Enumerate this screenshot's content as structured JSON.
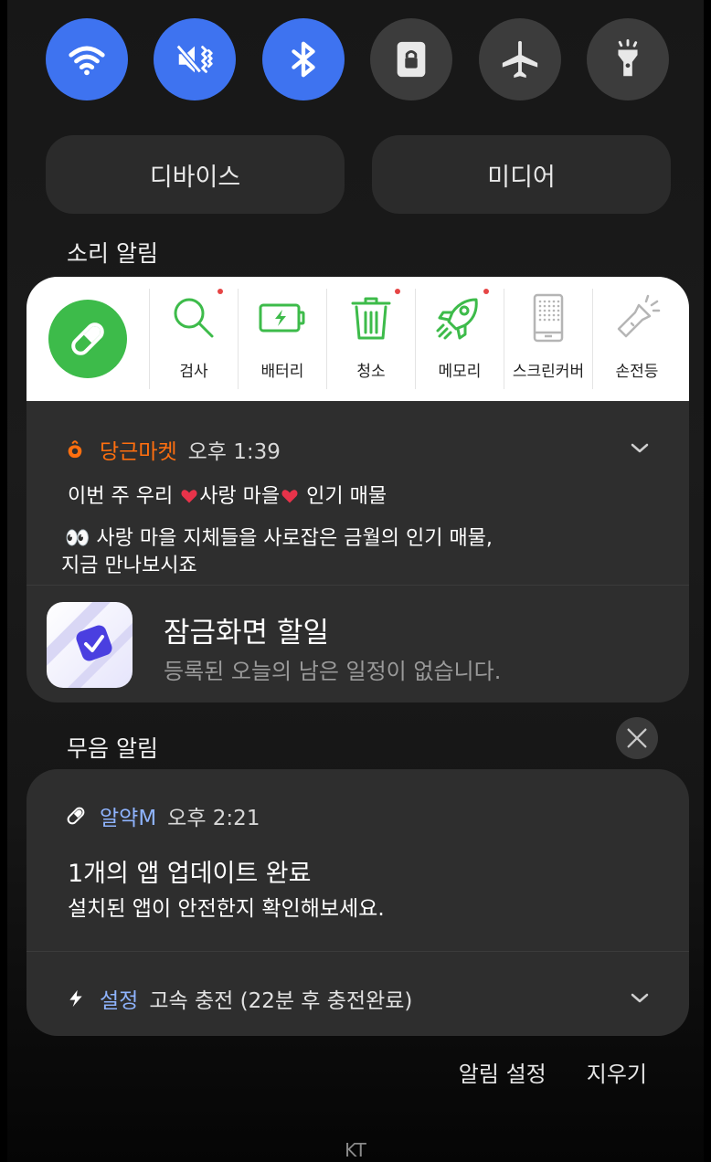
{
  "quick_toggles": [
    {
      "name": "wifi",
      "state": "on"
    },
    {
      "name": "mute",
      "state": "on"
    },
    {
      "name": "bluetooth",
      "state": "on"
    },
    {
      "name": "screen-lock",
      "state": "off"
    },
    {
      "name": "airplane-mode",
      "state": "off"
    },
    {
      "name": "flashlight",
      "state": "off"
    }
  ],
  "panel_buttons": {
    "device": "디바이스",
    "media": "미디어"
  },
  "sections": {
    "sound": "소리 알림",
    "silent": "무음 알림"
  },
  "tools": {
    "items": [
      {
        "label": "검사",
        "icon": "magnifier-icon",
        "dot": true
      },
      {
        "label": "배터리",
        "icon": "battery-icon",
        "dot": false
      },
      {
        "label": "청소",
        "icon": "trash-icon",
        "dot": true
      },
      {
        "label": "메모리",
        "icon": "rocket-icon",
        "dot": true
      },
      {
        "label": "스크린커버",
        "icon": "phone-screen-icon",
        "dot": false
      },
      {
        "label": "손전등",
        "icon": "flashlight-icon",
        "dot": false
      }
    ]
  },
  "notifications": {
    "daangn": {
      "app": "당근마켓",
      "time": "오후 1:39",
      "title_a": "이번 주 우리 ",
      "title_b": "사랑 마을",
      "title_c": " 인기 매물",
      "body_emoji": "👀",
      "body_line1": " 사랑 마을 지체들을 사로잡은 금월의 인기 매물,",
      "body_line2": "지금 만나보시죠",
      "accent": "#ff6f0f"
    },
    "todo": {
      "title": "잠금화면 할일",
      "subtitle": "등록된 오늘의 남은 일정이 없습니다."
    },
    "yakm": {
      "app": "알약M",
      "time": "오후 2:21",
      "title": "1개의 앱 업데이트 완료",
      "body": "설치된 앱이 안전한지 확인해보세요.",
      "accent": "#8fb4ff"
    },
    "settings": {
      "app": "설정",
      "text": "고속 충전 (22분 후 충전완료)",
      "accent": "#8fb4ff"
    }
  },
  "footer": {
    "settings": "알림 설정",
    "clear": "지우기"
  },
  "carrier": "KT",
  "colors": {
    "toggle_on": "#3e73f0",
    "toggle_off": "#3c3c3c",
    "tool_green": "#3dbb4a"
  }
}
